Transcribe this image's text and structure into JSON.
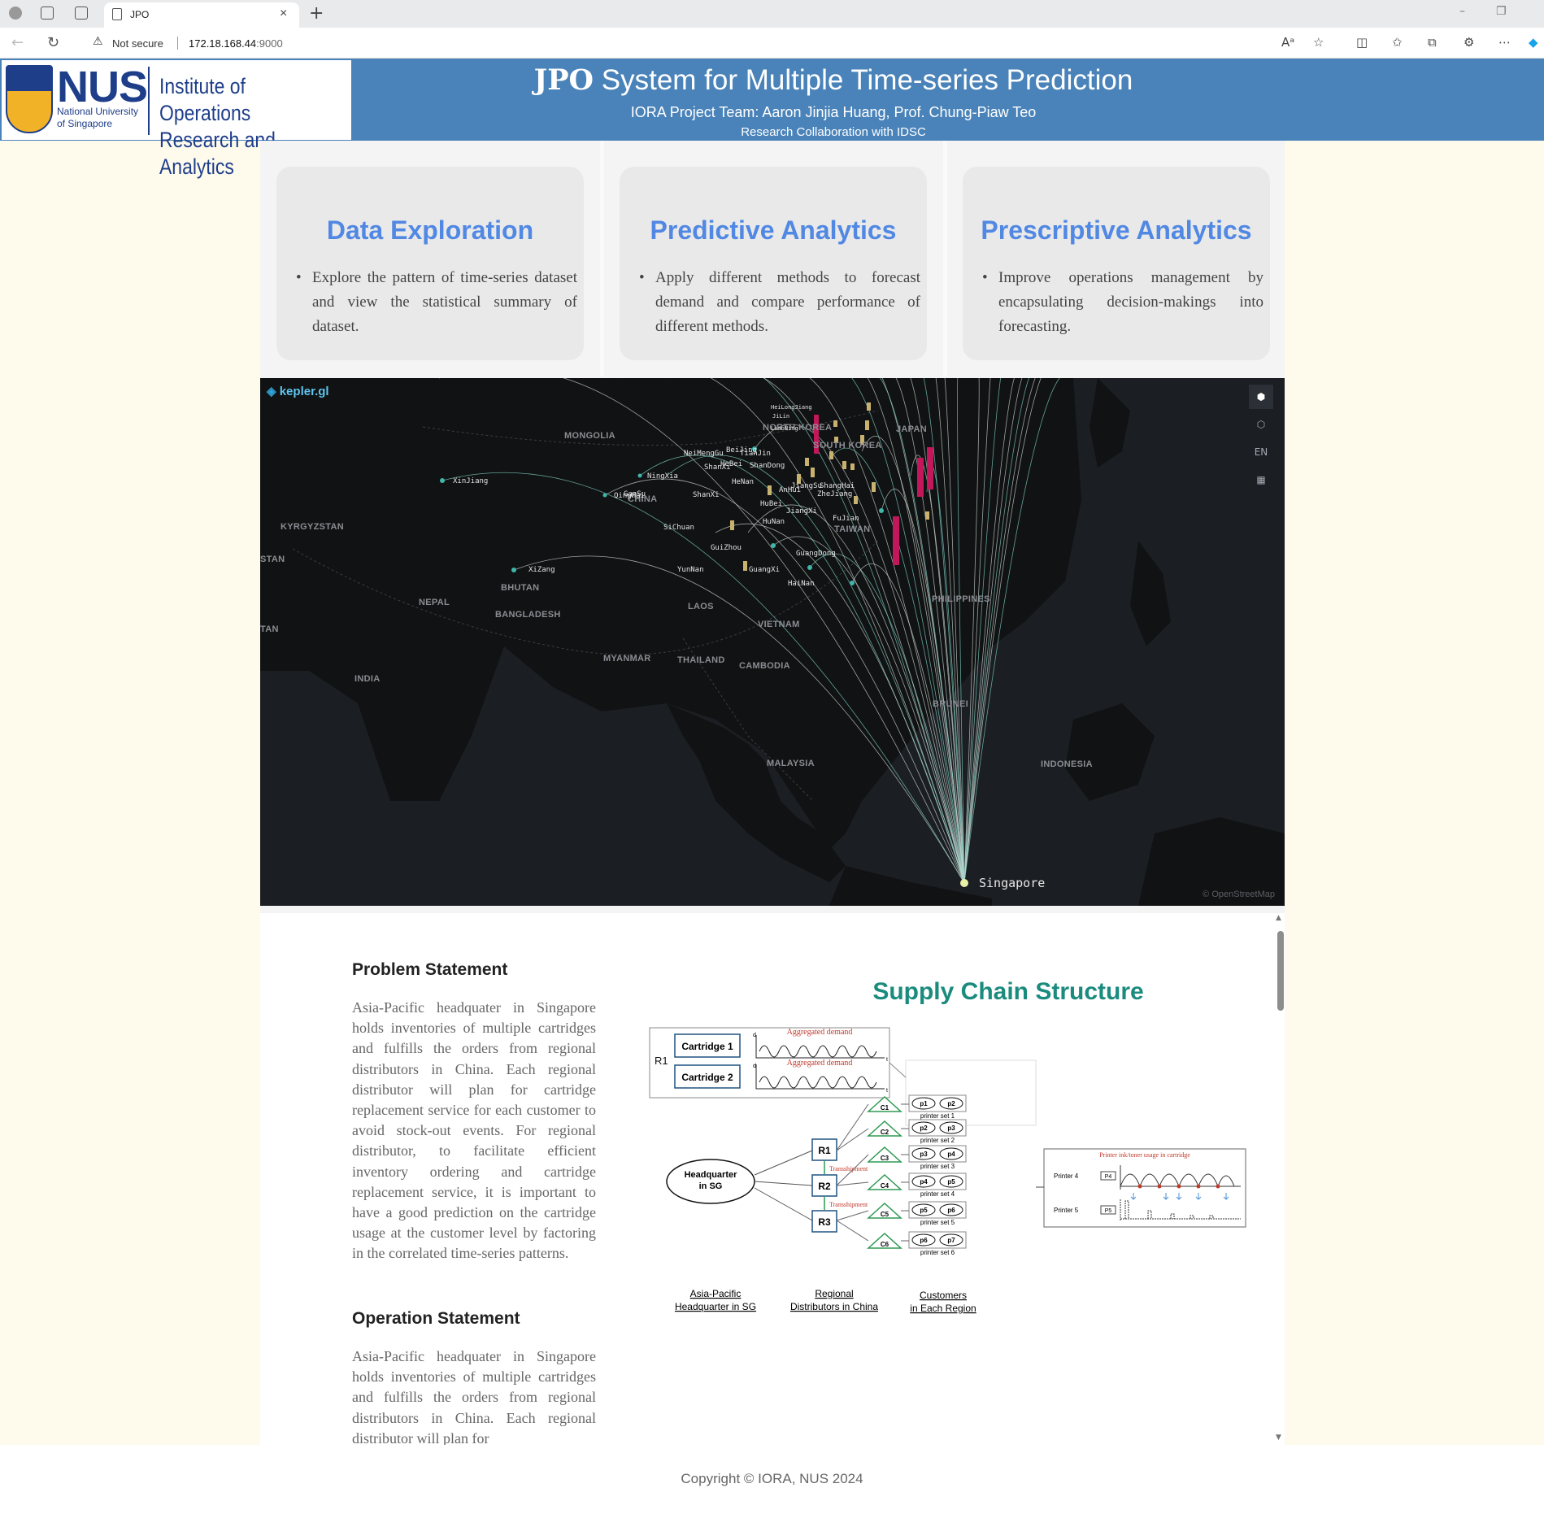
{
  "browser": {
    "tab_title": "JPO",
    "security_label": "Not secure",
    "url_host": "172.18.168.44",
    "url_port": ":9000"
  },
  "header": {
    "nus_wordmark": "NUS",
    "nus_subtitle": "National University of Singapore",
    "institute": "Institute of Operations Research and Analytics",
    "title_prefix": "JPO",
    "title_rest": " System for Multiple Time-series Prediction",
    "team": "IORA Project Team: Aaron Jinjia Huang, Prof. Chung-Piaw Teo",
    "collaboration": "Research Collaboration with IDSC",
    "background_color": "#4a83b9"
  },
  "cards": [
    {
      "title": "Data Exploration",
      "text": "Explore the pattern of time-series dataset and view the statistical summary of dataset."
    },
    {
      "title": "Predictive Analytics",
      "text": "Apply different methods to forecast demand and compare performance of different methods."
    },
    {
      "title": "Prescriptive Analytics",
      "text": "Improve operations management by encapsulating decision-makings into forecasting."
    }
  ],
  "map": {
    "brand": "kepler.gl",
    "attribution": "© OpenStreetMap",
    "locale_button": "EN",
    "countries": [
      "MONGOLIA",
      "KYRGYZSTAN",
      "JAPAN",
      "NORTH KOREA",
      "SOUTH KOREA",
      "CHINA",
      "TAIWAN",
      "NEPAL",
      "BHUTAN",
      "BANGLADESH",
      "INDIA",
      "MYANMAR",
      "LAOS",
      "THAILAND",
      "VIETNAM",
      "CAMBODIA",
      "PHILIPPINES",
      "BRUNEI",
      "MALAYSIA",
      "INDONESIA",
      "STAN",
      "TAN"
    ],
    "provinces": [
      "XinJiang",
      "XiZang",
      "QingHai",
      "GanSu",
      "NingXia",
      "NeiMengGu",
      "ShanXi",
      "HeBei",
      "BeiJing",
      "TianJin",
      "ShanDong",
      "HeNan",
      "AnHui",
      "JiangSu",
      "ShangHai",
      "ZheJiang",
      "HuBei",
      "JiangXi",
      "HuNan",
      "FuJian",
      "SiChuan",
      "GuiZhou",
      "YunNan",
      "GuangXi",
      "GuangDong",
      "HaiNan",
      "ShanXi",
      "HeiLongJiang",
      "JiLin",
      "LiaoNing"
    ],
    "hub_label": "Singapore"
  },
  "problem": {
    "heading": "Problem Statement",
    "text": "Asia-Pacific headquater in Singapore holds inventories of multiple cartridges and fulfills the orders from regional distributors in China. Each regional distributor will plan for cartridge replacement service for each customer to avoid stock-out events. For regional distributor, to facilitate efficient inventory ordering and cartridge replacement service, it is important to have a good prediction on the cartridge usage at the customer level by factoring in the correlated time-series patterns."
  },
  "operation": {
    "heading": "Operation Statement",
    "text": "Asia-Pacific headquater in Singapore holds inventories of multiple cartridges and fulfills the orders from regional distributors in China. Each regional distributor will plan for"
  },
  "diagram": {
    "title": "Supply Chain Structure",
    "r1_label": "R1",
    "cartridges": [
      "Cartridge 1",
      "Cartridge 2"
    ],
    "aggregated_demand": "Aggregated demand",
    "axis_d": "d",
    "axis_t": "t",
    "hq": "Headquarter in SG",
    "regions": [
      "R1",
      "R2",
      "R3"
    ],
    "transshipment": "Transshipment",
    "customers": [
      "C1",
      "C2",
      "C3",
      "C4",
      "C5",
      "C6"
    ],
    "printer_pairs": [
      [
        "p1",
        "p2"
      ],
      [
        "p2",
        "p3"
      ],
      [
        "p3",
        "p4"
      ],
      [
        "p4",
        "p5"
      ],
      [
        "p5",
        "p6"
      ],
      [
        "p6",
        "p7"
      ]
    ],
    "printer_sets": [
      "printer set 1",
      "printer set 2",
      "printer set 3",
      "printer set 4",
      "printer set 5",
      "printer set 6"
    ],
    "usage_title": "Printer ink/toner usage in cartridge",
    "printer4": "Printer 4",
    "printer5": "Printer 5",
    "p4": "P4",
    "p5": "P5",
    "col_labels": [
      "Asia-Pacific Headquarter in SG",
      "Regional Distributors in China",
      "Customers in Each Region"
    ]
  },
  "footer": {
    "copyright": "Copyright © IORA, NUS 2024"
  }
}
